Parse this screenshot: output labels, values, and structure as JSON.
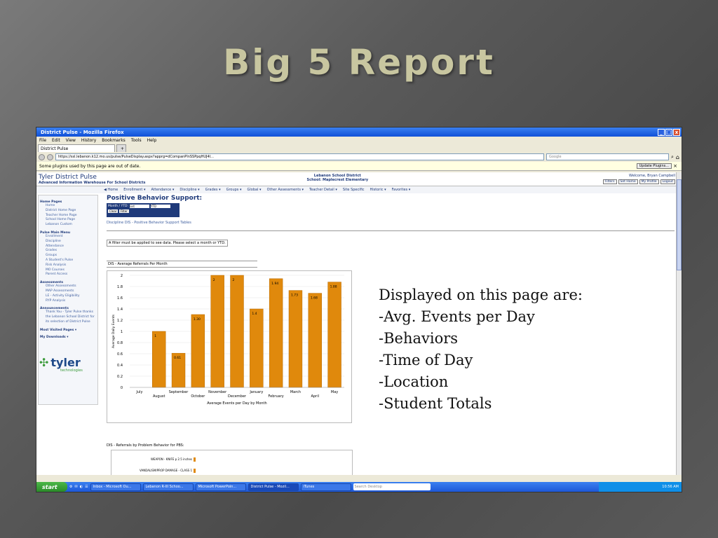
{
  "slide": {
    "title": "Big 5 Report",
    "bullets": [
      "Displayed on this page are:",
      "-Avg. Events per Day",
      "-Behaviors",
      "-Time of Day",
      "-Location",
      "-Student Totals"
    ]
  },
  "browser": {
    "window_title": "District Pulse - Mozilla Firefox",
    "menu": [
      "File",
      "Edit",
      "View",
      "History",
      "Bookmarks",
      "Tools",
      "Help"
    ],
    "tab_label": "District Pulse",
    "tab_plus": "+",
    "url": "https://ssl.lebanon.k12.mo.us/pulse/PulseDisplay.aspx?apprg=dCompanPlnSSPpqHUJ4I...",
    "search_placeholder": "Google",
    "notification": "Some plugins used by this page are out of date.",
    "update_plugins": "Update Plugins...",
    "close_x": "×"
  },
  "app": {
    "brand_title": "Tyler District Pulse",
    "brand_subtitle": "Advanced Information Warehouse For School Districts",
    "district_line1": "Lebanon School District",
    "district_line2": "School: Maplecrest Elementary",
    "welcome": "Welcome, Bryan Campbell",
    "header_buttons": [
      "Filters",
      "Set Home",
      "My Profile",
      "Logout"
    ],
    "top_menu": [
      "◀ Home",
      "Enrollment ▾",
      "Attendance ▾",
      "Discipline ▾",
      "Grades ▾",
      "Groups ▾",
      "Global ▾",
      "Other Assessments ▾",
      "Teacher Detail ▾",
      "Site Specific",
      "Historic ▾",
      "Favorites ▾"
    ],
    "sidebar": {
      "home_pages": "Home Pages",
      "home_items": [
        "Home",
        "District Home Page",
        "Teacher Home Page",
        "School Home Page",
        "Lebanon Custom"
      ],
      "main_menu": "Pulse Main Menu",
      "main_items": [
        "Enrollment",
        "Discipline",
        "Attendance",
        "Grades",
        "Groups",
        "A Student's Pulse",
        "Risk Analysis",
        "MO Courses",
        "Parent Access"
      ],
      "assessments": "Assessments",
      "assess_items": [
        "Other Assessments",
        "MAP Assessments",
        "LE - Activity Eligibility",
        "RYP Analysis"
      ],
      "announcements": "Announcements",
      "announce_items": [
        "Thank You - Tyler Pulse thanks the Lebanon School District for its selection of District Pulse"
      ],
      "most_visited": "Most Visited Pages ▾",
      "downloads": "My Downloads ▾",
      "logo": "tyler",
      "logo_sub": "technologies"
    },
    "page_title": "Positive Behavior Support:",
    "filter": {
      "label": "Month / YTD:",
      "list_value": "List",
      "ytd_value": "YTD",
      "clear": "Clear",
      "filter": "Filter"
    },
    "breadcrumb": "Discipline     DIS - Positive Behavior Support Tables",
    "warning": "A filter must be applied to see data. Please select a month or YTD.",
    "chart_title": "DIS - Average Referrals Per Month",
    "chart2_title": "DIS - Referrals by Problem Behavior for PBS:",
    "chart2_rows": [
      "WEAPON - KNIFE p 2.5 inches",
      "VANDALISM/PROP DAMAGE - CLASS 1"
    ]
  },
  "chart_data": {
    "type": "bar",
    "categories": [
      "July",
      "August",
      "September",
      "October",
      "November",
      "December",
      "January",
      "February",
      "March",
      "April",
      "May"
    ],
    "values": [
      1,
      0.61,
      1.3,
      2,
      2,
      1.4,
      1.94,
      1.73,
      1.68,
      1.88
    ],
    "bar_categories": [
      "August",
      "September",
      "October",
      "November",
      "December",
      "January",
      "February",
      "March",
      "April",
      "May"
    ],
    "data_labels": [
      "1",
      "0.61",
      "1.30",
      "2",
      "2",
      "1.4",
      "1.94",
      "1.73",
      "1.68",
      "1.88"
    ],
    "xlabel": "Average Events per Day by Month",
    "ylabel": "Average Daily Events",
    "ylim": [
      0,
      2
    ],
    "yticks": [
      "0",
      "0.2",
      "0.4",
      "0.6",
      "0.8",
      "1",
      "1.2",
      "1.4",
      "1.6",
      "1.8",
      "2"
    ],
    "grid": true,
    "bar_color": "#e0890c"
  },
  "taskbar": {
    "start": "start",
    "tasks": [
      "Inbox - Microsoft Ou...",
      "Lebanon R-III Schoo...",
      "Microsoft PowerPoin...",
      "District Pulse - Mozil...",
      "iTunes"
    ],
    "active_index": 3,
    "search": "Search Desktop",
    "clock": "10:56 AM"
  }
}
